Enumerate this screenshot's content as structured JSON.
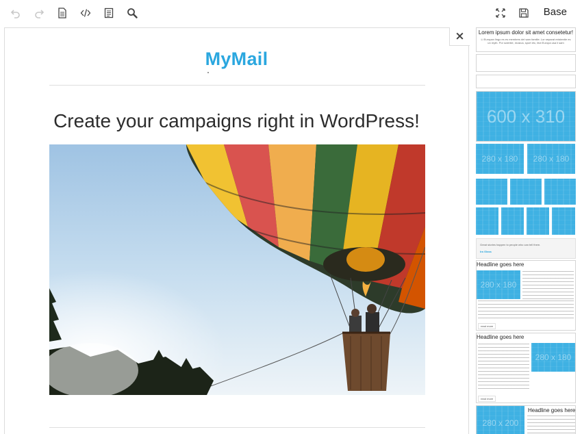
{
  "toolbar": {
    "undo_icon": "undo-icon",
    "redo_icon": "redo-icon",
    "page_icon": "document-icon",
    "code_icon": "code-icon",
    "plaintext_icon": "list-document-icon",
    "search_icon": "search-icon",
    "fullscreen_icon": "fullscreen-icon",
    "save_icon": "save-icon",
    "base_label": "Base"
  },
  "editor": {
    "close_symbol": "×",
    "logo_text": "MyMail",
    "headline": "Create your campaigns right in WordPress!"
  },
  "sidebar": {
    "module1_title": "Lorem ipsum dolor sit amet consetetur!",
    "module1_text": "Li Europan lingo es es membres del sam familie. Lor separat existentie es un myth. Por scientie, musica, sport etc, litot Europa usa li sam",
    "placeholder_large": "600 x 310",
    "placeholder_pair": "280 x 180",
    "quote_text": "Great stories happen to people who can tell them.",
    "quote_author": "Ira Glass",
    "headline1": "Headline goes here",
    "headline2": "Headline goes here",
    "headline3": "Headline goes here",
    "readmore1": "read more",
    "readmore2": "read more",
    "placeholder_small": "280 x 200"
  },
  "colors": {
    "brand": "#2ba7df",
    "placeholder": "#3fb1e3"
  }
}
